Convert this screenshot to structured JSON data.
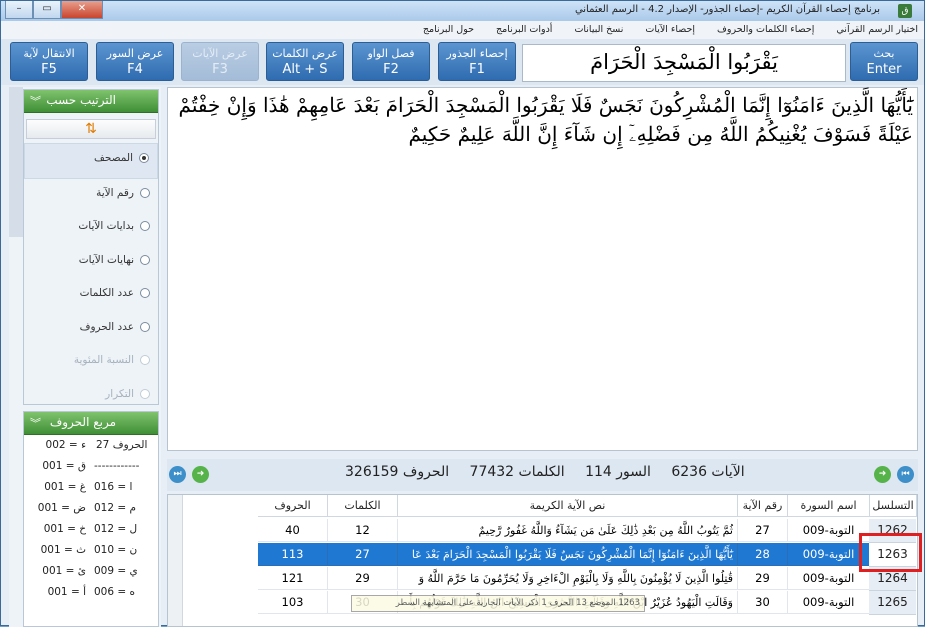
{
  "window": {
    "title": "برنامج إحصاء القرآن الكريم -إحصاء الجذور- الإصدار 4.2 - الرسم العثماني",
    "minimize": "–",
    "maximize": "▭",
    "close": "✕"
  },
  "menu": [
    "اختيار الرسم القرآني",
    "إحصاء الكلمات والحروف",
    "إحصاء الآيات",
    "نسخ البيانات",
    "أدوات البرنامج",
    "حول البرنامج"
  ],
  "toolbar": {
    "search": {
      "label": "بحث",
      "key": "Enter"
    },
    "roots": {
      "label": "إحصاء الجذور",
      "key": "F1"
    },
    "waw": {
      "label": "فصل الواو",
      "key": "F2"
    },
    "words": {
      "label": "عرض الكلمات",
      "key": "Alt + S"
    },
    "ayat": {
      "label": "عرض الآيات",
      "key": "F3"
    },
    "suras": {
      "label": "عرض السور",
      "key": "F4"
    },
    "goto": {
      "label": "الانتقال لآية",
      "key": "F5"
    }
  },
  "search_text": "يَقْرَبُوا الْمَسْجِدَ الْحَرَامَ",
  "verse_text": "يَٰٓأَيُّهَا الَّذِينَ ءَامَنُوٓا إِنَّمَا الْمُشْرِكُونَ نَجَسٌ فَلَا يَقْرَبُوا الْمَسْجِدَ الْحَرَامَ بَعْدَ عَامِهِمْ هَٰذَا وَإِنْ خِفْتُمْ عَيْلَةً فَسَوْفَ يُغْنِيكُمُ اللَّهُ مِن فَضْلِهِۦٓ إِن شَآءَ إِنَّ اللَّهَ عَلِيمٌ حَكِيمٌ",
  "sort_panel": {
    "title": "الترتيب حسب",
    "sort_icon": "⇅",
    "options": [
      {
        "label": "المصحف",
        "checked": true,
        "enabled": true
      },
      {
        "label": "رقم الآية",
        "checked": false,
        "enabled": true
      },
      {
        "label": "بدايات الآيات",
        "checked": false,
        "enabled": true
      },
      {
        "label": "نهايات الآيات",
        "checked": false,
        "enabled": true
      },
      {
        "label": "عدد الكلمات",
        "checked": false,
        "enabled": true
      },
      {
        "label": "عدد الحروف",
        "checked": false,
        "enabled": true
      },
      {
        "label": "النسبة المئوية",
        "checked": false,
        "enabled": false
      },
      {
        "label": "التكرار",
        "checked": false,
        "enabled": false
      }
    ]
  },
  "letters_panel": {
    "title": "مربع الحروف",
    "header_left": "002 = ء",
    "header_right": "الحروف 27",
    "rows": [
      {
        "left": "001 = ق",
        "right": "------------"
      },
      {
        "left": "001 = غ",
        "right": "016 = ا"
      },
      {
        "left": "001 = ض",
        "right": "012 = م"
      },
      {
        "left": "001 = خ",
        "right": "012 = ل"
      },
      {
        "left": "001 = ث",
        "right": "010 = ن"
      },
      {
        "left": "001 = ئ",
        "right": "009 = ي"
      },
      {
        "left": "001 = أ",
        "right": "006 = ه"
      }
    ]
  },
  "stats": {
    "ayat": "الآيات 6236",
    "suras": "السور 114",
    "words": "الكلمات 77432",
    "letters": "الحروف 326159"
  },
  "table": {
    "headers": {
      "serial": "التسلسل",
      "sura": "اسم السورة",
      "ayah": "رقم الآية",
      "text": "نص الآية الكريمة",
      "words": "الكلمات",
      "letters": "الحروف"
    },
    "rows": [
      {
        "serial": "1262",
        "sura": "009-التوبة",
        "ayah": "27",
        "text": "ثُمَّ يَتُوبُ اللَّهُ مِن بَعْدِ ذَٰلِكَ عَلَىٰ مَن يَشَآءُ وَاللَّهُ غَفُورٌ رَّحِيمٌ",
        "words": "12",
        "letters": "40"
      },
      {
        "serial": "1263",
        "sura": "009-التوبة",
        "ayah": "28",
        "text": "يَٰٓأَيُّهَا الَّذِينَ ءَامَنُوٓا إِنَّمَا الْمُشْرِكُونَ نَجَسٌ فَلَا يَقْرَبُوا الْمَسْجِدَ الْحَرَامَ بَعْدَ عَا",
        "words": "27",
        "letters": "113",
        "selected": true
      },
      {
        "serial": "1264",
        "sura": "009-التوبة",
        "ayah": "29",
        "text": "قَٰتِلُوا الَّذِينَ لَا يُؤْمِنُونَ بِاللَّهِ وَلَا بِالْيَوْمِ الْءَاخِرِ وَلَا يُحَرِّمُونَ مَا حَرَّمَ اللَّهُ وَ",
        "words": "29",
        "letters": "121"
      },
      {
        "serial": "1265",
        "sura": "009-التوبة",
        "ayah": "30",
        "text": "وَقَالَتِ الْيَهُودُ عُزَيْرٌ ابْنُ اللَّهِ وَقَالَتِ النَّصَٰرَى الْمَسِيحُ ابْنُ اللَّهِ ذَٰلِكَ قَوْلُهُم بِأَ",
        "words": "30",
        "letters": "103"
      }
    ]
  },
  "tooltip": "1263 الموضع 13 الحرف 1 ذكر الآيات الجارية على المتشابهة السطر"
}
